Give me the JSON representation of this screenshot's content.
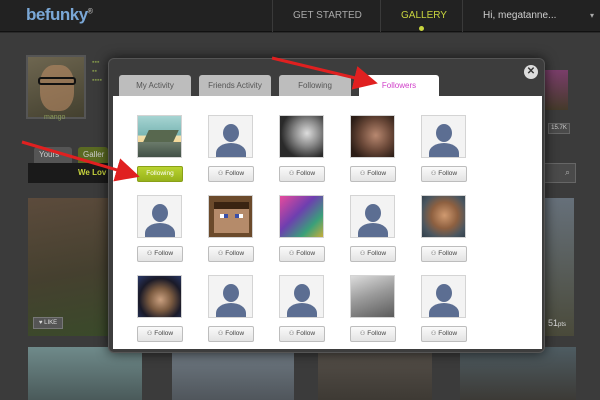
{
  "topbar": {
    "logo_main": "befunky",
    "logo_mark": "®",
    "nav_started": "GET STARTED",
    "nav_gallery": "GALLERY",
    "nav_user": "Hi, megatanne...",
    "user_caret": "▾"
  },
  "background": {
    "tab_yours": "Yours",
    "tab_gallery": "Galler",
    "love_bar": "We Lov",
    "username": "mango",
    "count_badge": "15.7K",
    "like_label": "LIKE",
    "time_label": "51",
    "time_unit": "pts",
    "search_icon": "⌕",
    "like_icon": "♥"
  },
  "modal": {
    "close_glyph": "✕",
    "tabs": [
      {
        "label": "My Activity",
        "active": false
      },
      {
        "label": "Friends Activity",
        "active": false
      },
      {
        "label": "Following",
        "active": false
      },
      {
        "label": "Followers",
        "active": true
      }
    ],
    "active_tab_color": "#d03fc9",
    "follow_icon": "people-icon",
    "users": [
      {
        "avatar": "photo-building",
        "button": "Following",
        "state": "following"
      },
      {
        "avatar": "default-silhouette",
        "button": "Follow",
        "state": "follow"
      },
      {
        "avatar": "photo-guy-bw",
        "button": "Follow",
        "state": "follow"
      },
      {
        "avatar": "photo-girl",
        "button": "Follow",
        "state": "follow"
      },
      {
        "avatar": "default-silhouette",
        "button": "Follow",
        "state": "follow"
      },
      {
        "avatar": "default-silhouette",
        "button": "Follow",
        "state": "follow"
      },
      {
        "avatar": "photo-minecraft",
        "button": "Follow",
        "state": "follow"
      },
      {
        "avatar": "photo-colorful",
        "button": "Follow",
        "state": "follow"
      },
      {
        "avatar": "default-silhouette",
        "button": "Follow",
        "state": "follow"
      },
      {
        "avatar": "photo-man-glasses",
        "button": "Follow",
        "state": "follow"
      },
      {
        "avatar": "photo-asian",
        "button": "Follow",
        "state": "follow"
      },
      {
        "avatar": "default-silhouette",
        "button": "Follow",
        "state": "follow"
      },
      {
        "avatar": "default-silhouette",
        "button": "Follow",
        "state": "follow"
      },
      {
        "avatar": "photo-kiss",
        "button": "Follow",
        "state": "follow"
      },
      {
        "avatar": "default-silhouette",
        "button": "Follow",
        "state": "follow"
      }
    ]
  },
  "colors": {
    "following_green": "#a4c024",
    "arrow_red": "#e02020",
    "accent_gallery": "#c8d43e"
  }
}
